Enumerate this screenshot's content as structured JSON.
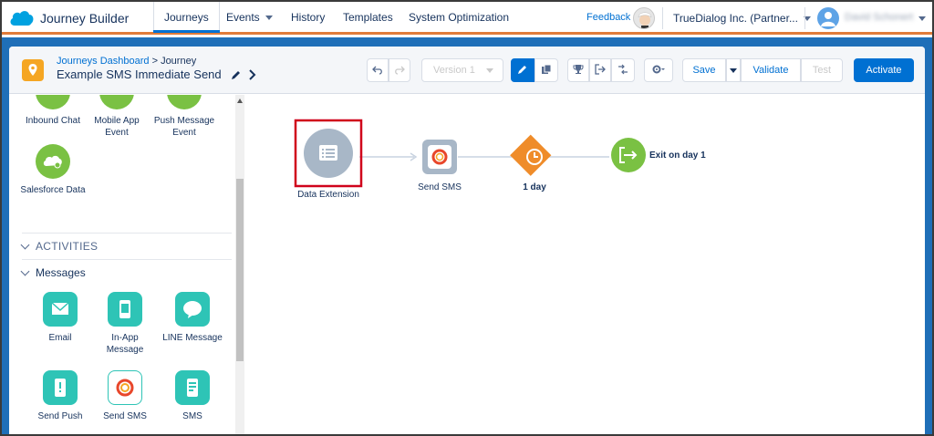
{
  "app": {
    "title": "Journey Builder"
  },
  "nav": {
    "items": [
      "Journeys",
      "Events",
      "History",
      "Templates",
      "System Optimization"
    ],
    "feedback": "Feedback",
    "org": "TrueDialog Inc. (Partner...",
    "user": "David Schonert"
  },
  "journey": {
    "breadcrumb_link": "Journeys Dashboard",
    "breadcrumb_sep": " > ",
    "breadcrumb_current": "Journey",
    "name": "Example SMS Immediate Send",
    "version": "Version 1",
    "save": "Save",
    "validate": "Validate",
    "test": "Test",
    "activate": "Activate"
  },
  "sidebar": {
    "entry_sources": [
      {
        "label": "Inbound Chat",
        "icon": "chat-icon"
      },
      {
        "label": "Mobile App Event",
        "icon": "mobile-app-icon"
      },
      {
        "label": "Push Message Event",
        "icon": "push-icon"
      },
      {
        "label": "Salesforce Data",
        "icon": "salesforce-cloud-icon"
      }
    ],
    "activities_label": "ACTIVITIES",
    "messages_label": "Messages",
    "messages": [
      {
        "label": "Email",
        "icon": "email-icon"
      },
      {
        "label": "In-App Message",
        "icon": "in-app-icon"
      },
      {
        "label": "LINE Message",
        "icon": "line-icon"
      },
      {
        "label": "Send Push",
        "icon": "send-push-icon"
      },
      {
        "label": "Send SMS",
        "icon": "sms-logo-icon"
      },
      {
        "label": "SMS",
        "icon": "sms-phone-icon"
      }
    ]
  },
  "canvas": {
    "entry_label": "Data Extension",
    "sms_label": "Send SMS",
    "wait_label": "1 day",
    "exit_label": "Exit on day 1"
  },
  "colors": {
    "accent_blue": "#0070d2",
    "band_blue": "#1f6fb8",
    "teal": "#2ec4b6",
    "green": "#7ac143",
    "orange": "#ef8c2a",
    "highlight_red": "#d0021b"
  }
}
